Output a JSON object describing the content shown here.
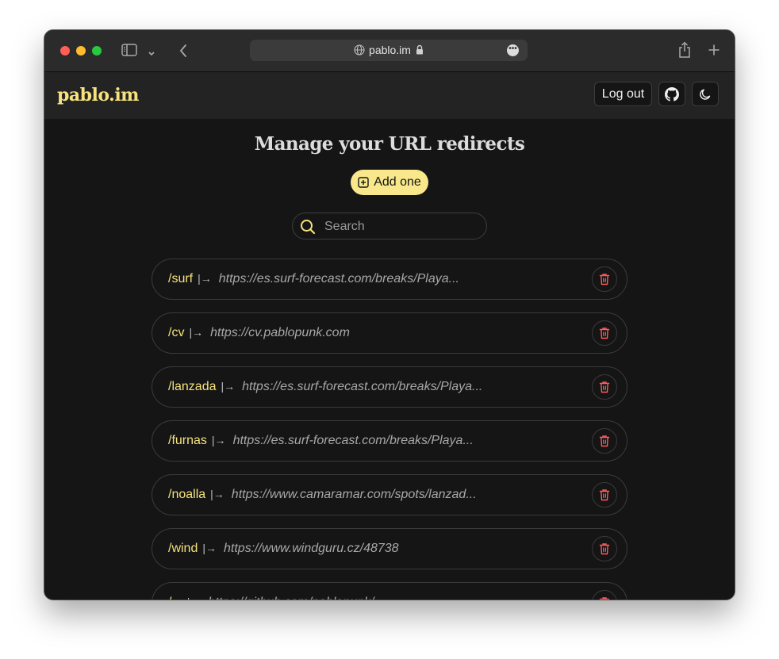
{
  "browser": {
    "host": "pablo.im"
  },
  "app": {
    "brand": "pablo.im",
    "logout_label": "Log out"
  },
  "page": {
    "title": "Manage your URL redirects",
    "add_label": "Add one",
    "search_placeholder": "Search"
  },
  "redirects": [
    {
      "slug": "/surf",
      "target": "https://es.surf-forecast.com/breaks/Playa..."
    },
    {
      "slug": "/cv",
      "target": "https://cv.pablopunk.com"
    },
    {
      "slug": "/lanzada",
      "target": "https://es.surf-forecast.com/breaks/Playa..."
    },
    {
      "slug": "/furnas",
      "target": "https://es.surf-forecast.com/breaks/Playa..."
    },
    {
      "slug": "/noalla",
      "target": "https://www.camaramar.com/spots/lanzad..."
    },
    {
      "slug": "/wind",
      "target": "https://www.windguru.cz/48738"
    },
    {
      "slug": "/...",
      "target": "https://github.com/pablopunk/..."
    }
  ],
  "colors": {
    "accent": "#f6e27c",
    "button": "#f8e88b",
    "danger": "#ff5a5f",
    "background": "#151515"
  }
}
